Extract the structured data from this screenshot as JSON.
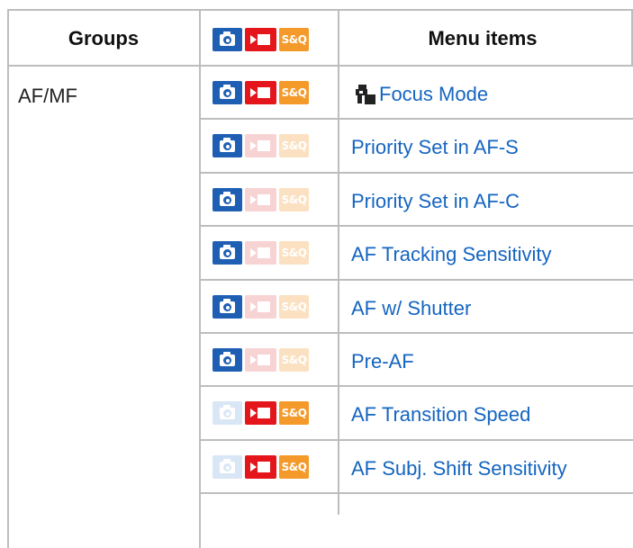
{
  "header": {
    "groups": "Groups",
    "menu_items": "Menu items",
    "snq_label": "S&Q"
  },
  "group": "AF/MF",
  "icon_colors": {
    "still": "#1e5fb4",
    "movie": "#e4161c",
    "snq": "#f39a2a"
  },
  "rows": [
    {
      "label": "Focus Mode",
      "still": true,
      "movie": true,
      "snq": true,
      "icon": "focus-mode-icon"
    },
    {
      "label": "Priority Set in AF-S",
      "still": true,
      "movie": false,
      "snq": false
    },
    {
      "label": "Priority Set in AF-C",
      "still": true,
      "movie": false,
      "snq": false
    },
    {
      "label": "AF Tracking Sensitivity",
      "still": true,
      "movie": false,
      "snq": false
    },
    {
      "label": "AF w/ Shutter",
      "still": true,
      "movie": false,
      "snq": false
    },
    {
      "label": "Pre-AF",
      "still": true,
      "movie": false,
      "snq": false
    },
    {
      "label": "AF Transition Speed",
      "still": false,
      "movie": true,
      "snq": true
    },
    {
      "label": "AF Subj. Shift Sensitivity",
      "still": false,
      "movie": true,
      "snq": true
    }
  ]
}
